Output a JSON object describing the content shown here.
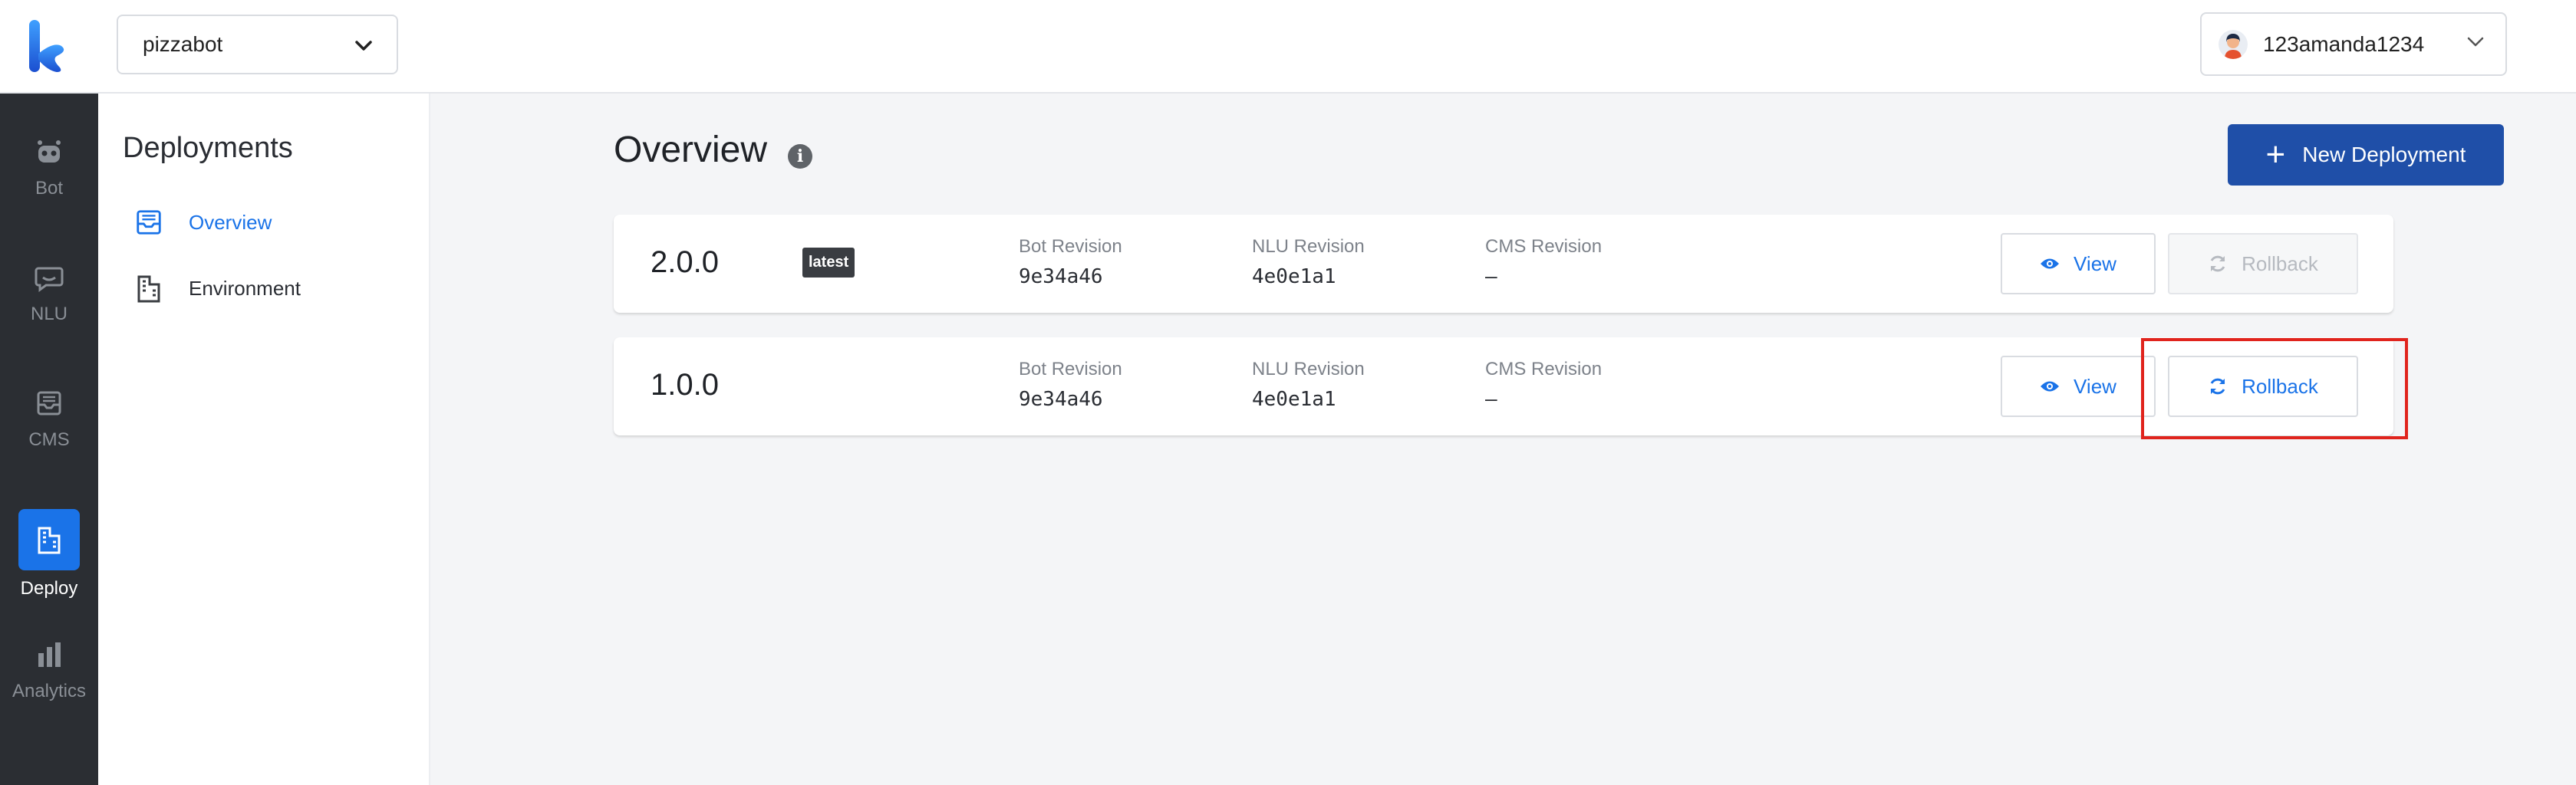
{
  "header": {
    "bot_selector": {
      "value": "pizzabot"
    },
    "user_menu": {
      "username": "123amanda1234"
    }
  },
  "rail": {
    "items": [
      {
        "label": "Bot",
        "icon": "robot-icon"
      },
      {
        "label": "NLU",
        "icon": "chat-bubble-icon"
      },
      {
        "label": "CMS",
        "icon": "inbox-icon"
      },
      {
        "label": "Deploy",
        "icon": "building-icon",
        "active": true
      },
      {
        "label": "Analytics",
        "icon": "bar-chart-icon"
      }
    ]
  },
  "subnav": {
    "title": "Deployments",
    "items": [
      {
        "label": "Overview",
        "icon": "inbox-icon",
        "active": true
      },
      {
        "label": "Environment",
        "icon": "building-icon"
      }
    ]
  },
  "main": {
    "title": "Overview",
    "new_button_label": "New Deployment",
    "column_labels": {
      "bot": "Bot Revision",
      "nlu": "NLU Revision",
      "cms": "CMS Revision"
    },
    "deployments": [
      {
        "version": "2.0.0",
        "badge": "latest",
        "bot_revision": "9e34a46",
        "nlu_revision": "4e0e1a1",
        "cms_revision": "–",
        "view_label": "View",
        "rollback_label": "Rollback",
        "rollback_enabled": false
      },
      {
        "version": "1.0.0",
        "badge": "",
        "bot_revision": "9e34a46",
        "nlu_revision": "4e0e1a1",
        "cms_revision": "–",
        "view_label": "View",
        "rollback_label": "Rollback",
        "rollback_enabled": true
      }
    ]
  },
  "colors": {
    "accent": "#1a73e8",
    "primary_button": "#1f4fa8",
    "rail_bg": "#2b2e33",
    "highlight": "#e0241d"
  }
}
